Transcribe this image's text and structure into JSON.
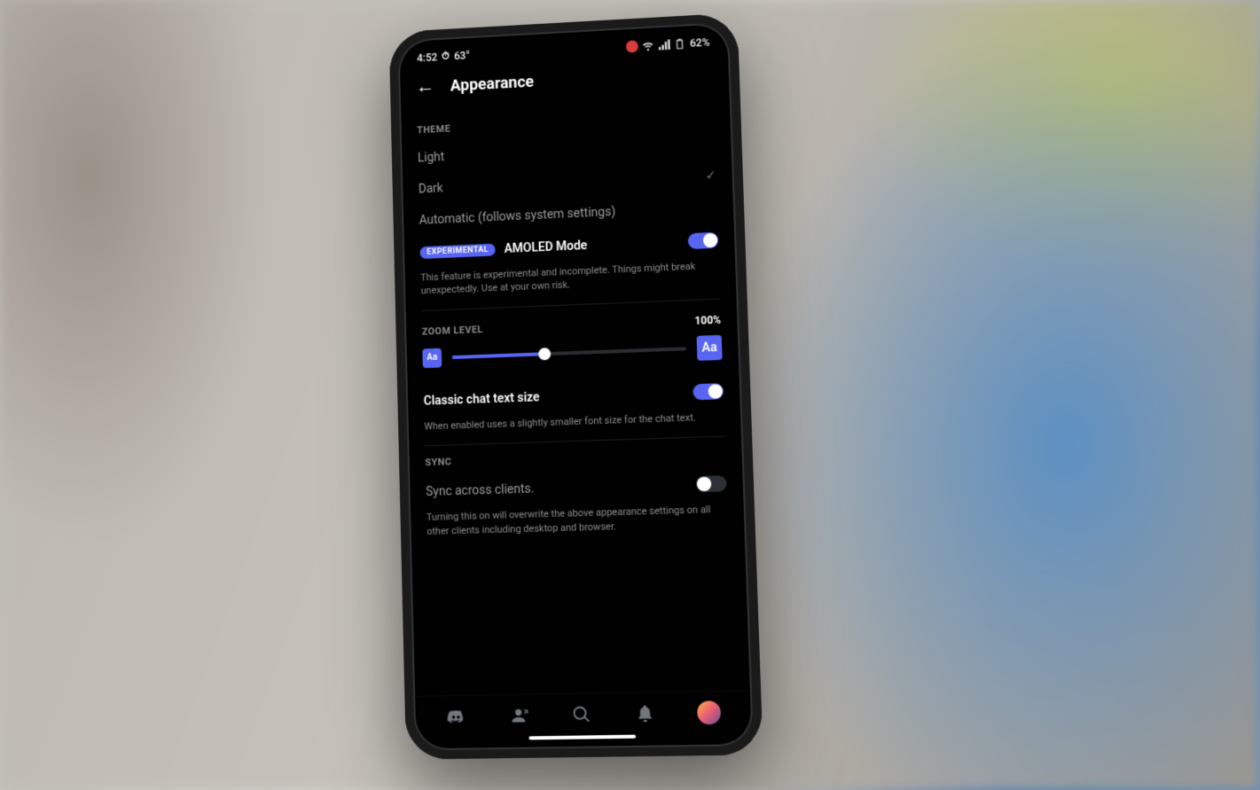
{
  "status": {
    "time": "4:52",
    "temp": "63°",
    "battery": "62%"
  },
  "header": {
    "title": "Appearance"
  },
  "theme": {
    "section": "THEME",
    "options": {
      "light": "Light",
      "dark": "Dark",
      "auto": "Automatic (follows system settings)"
    },
    "selected": "dark",
    "amoled": {
      "badge": "EXPERIMENTAL",
      "label": "AMOLED Mode",
      "enabled": true,
      "description": "This feature is experimental and incomplete. Things might break unexpectedly. Use at your own risk."
    }
  },
  "zoom": {
    "section": "ZOOM LEVEL",
    "value": "100%",
    "slider_percent": 40,
    "small_marker": "Aa",
    "large_marker": "Aa"
  },
  "classic_chat": {
    "label": "Classic chat text size",
    "enabled": true,
    "description": "When enabled uses a slightly smaller font size for the chat text."
  },
  "sync": {
    "section": "SYNC",
    "label": "Sync across clients.",
    "enabled": false,
    "description": "Turning this on will overwrite the above appearance settings on all other clients including desktop and browser."
  }
}
